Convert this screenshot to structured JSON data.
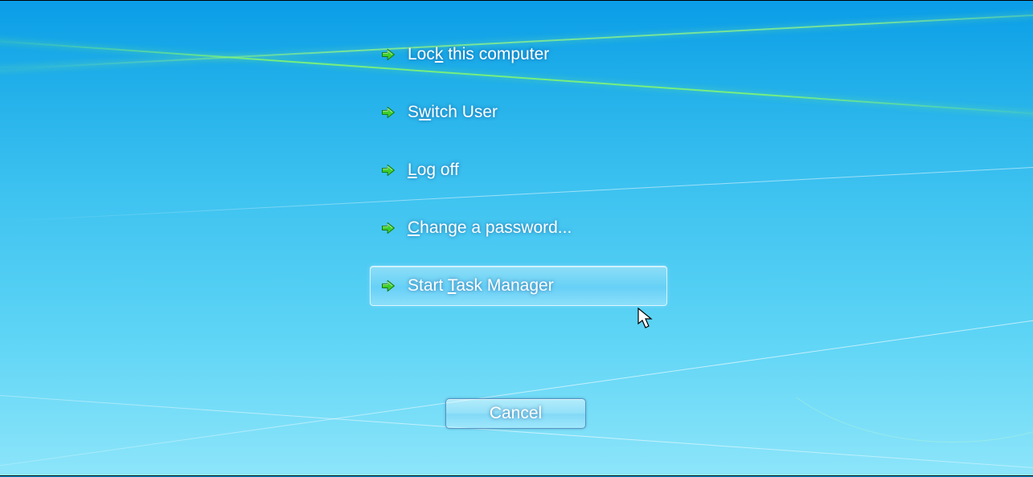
{
  "menu": {
    "items": [
      {
        "pre": "Loc",
        "u": "k",
        "post": " this computer",
        "name": "lock-this-computer-link"
      },
      {
        "pre": "S",
        "u": "w",
        "post": "itch User",
        "name": "switch-user-link"
      },
      {
        "pre": "",
        "u": "L",
        "post": "og off",
        "name": "log-off-link"
      },
      {
        "pre": "",
        "u": "C",
        "post": "hange a password...",
        "name": "change-password-link"
      },
      {
        "pre": "Start ",
        "u": "T",
        "post": "ask Manager",
        "name": "start-task-manager-link",
        "hovered": true
      }
    ]
  },
  "cancel_label": "Cancel",
  "colors": {
    "arrow_fill": "#3fcf2e",
    "arrow_stroke": "#1a7a0e"
  }
}
